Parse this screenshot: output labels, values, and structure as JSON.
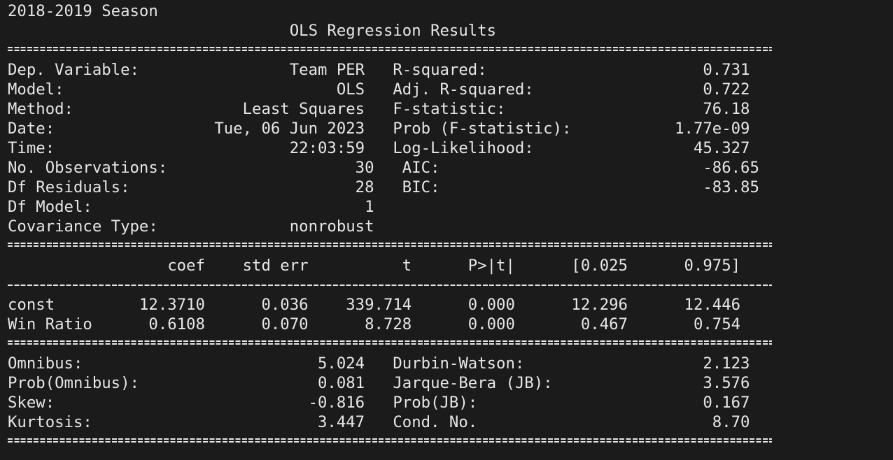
{
  "terminal": {
    "lines": [
      "2018-2019 Season",
      "                              OLS Regression Results",
      "Dep. Variable:                Team PER   R-squared:                       0.731",
      "Model:                             OLS   Adj. R-squared:                  0.722",
      "Method:                  Least Squares   F-statistic:                     76.18",
      "Date:                 Tue, 06 Jun 2023   Prob (F-statistic):           1.77e-09",
      "Time:                         22:03:59   Log-Likelihood:                 45.327",
      "No. Observations:                    30   AIC:                            -86.65",
      "Df Residuals:                        28   BIC:                            -83.85",
      "Df Model:                             1",
      "Covariance Type:              nonrobust",
      "                 coef    std err          t      P>|t|      [0.025      0.975]",
      "const         12.3710      0.036    339.714      0.000      12.296      12.446",
      "Win Ratio      0.6108      0.070      8.728      0.000       0.467       0.754",
      "Omnibus:                         5.024   Durbin-Watson:                   2.123",
      "Prob(Omnibus):                   0.081   Jarque-Bera (JB):                3.576",
      "Skew:                           -0.816   Prob(JB):                        0.167",
      "Kurtosis:                        3.447   Cond. No.                         8.70"
    ]
  }
}
